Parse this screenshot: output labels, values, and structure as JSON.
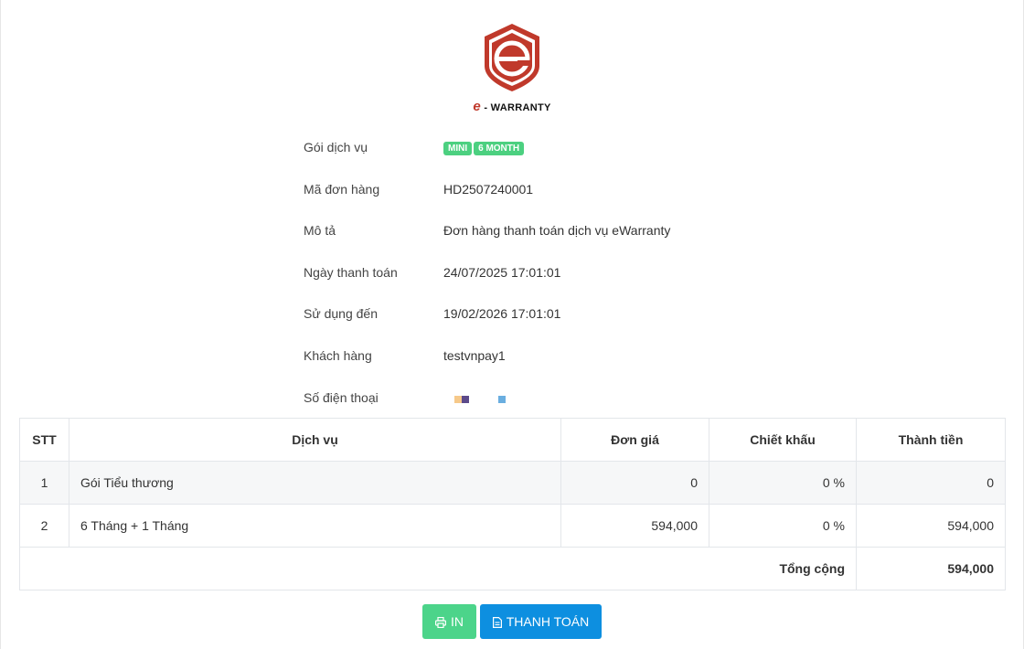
{
  "brand": {
    "logo_prefix": "e",
    "logo_text": " - WARRANTY",
    "color": "#c0392b"
  },
  "details": [
    {
      "label": "Gói dịch vụ",
      "badges": [
        "MINI",
        "6 MONTH"
      ]
    },
    {
      "label": "Mã đơn hàng",
      "value": "HD2507240001"
    },
    {
      "label": "Mô tả",
      "value": "Đơn hàng thanh toán dịch vụ eWarranty"
    },
    {
      "label": "Ngày thanh toán",
      "value": "24/07/2025 17:01:01"
    },
    {
      "label": "Sử dụng đến",
      "value": "19/02/2026 17:01:01"
    },
    {
      "label": "Khách hàng",
      "value": "testvnpay1"
    },
    {
      "label": "Số điện thoại",
      "value": ""
    }
  ],
  "table": {
    "headers": [
      "STT",
      "Dịch vụ",
      "Đơn giá",
      "Chiết khấu",
      "Thành tiền"
    ],
    "rows": [
      {
        "stt": "1",
        "service": "Gói Tiểu thương",
        "price": "0",
        "discount": "0 %",
        "amount": "0"
      },
      {
        "stt": "2",
        "service": "6 Tháng + 1 Tháng",
        "price": "594,000",
        "discount": "0 %",
        "amount": "594,000"
      }
    ],
    "total_label": "Tổng cộng",
    "total_value": "594,000"
  },
  "actions": {
    "print_label": "IN",
    "pay_label": "THANH TOÁN"
  },
  "colors": {
    "badge": "#4cd080",
    "print_button": "#4cd48a",
    "pay_button": "#0d8fe0"
  }
}
